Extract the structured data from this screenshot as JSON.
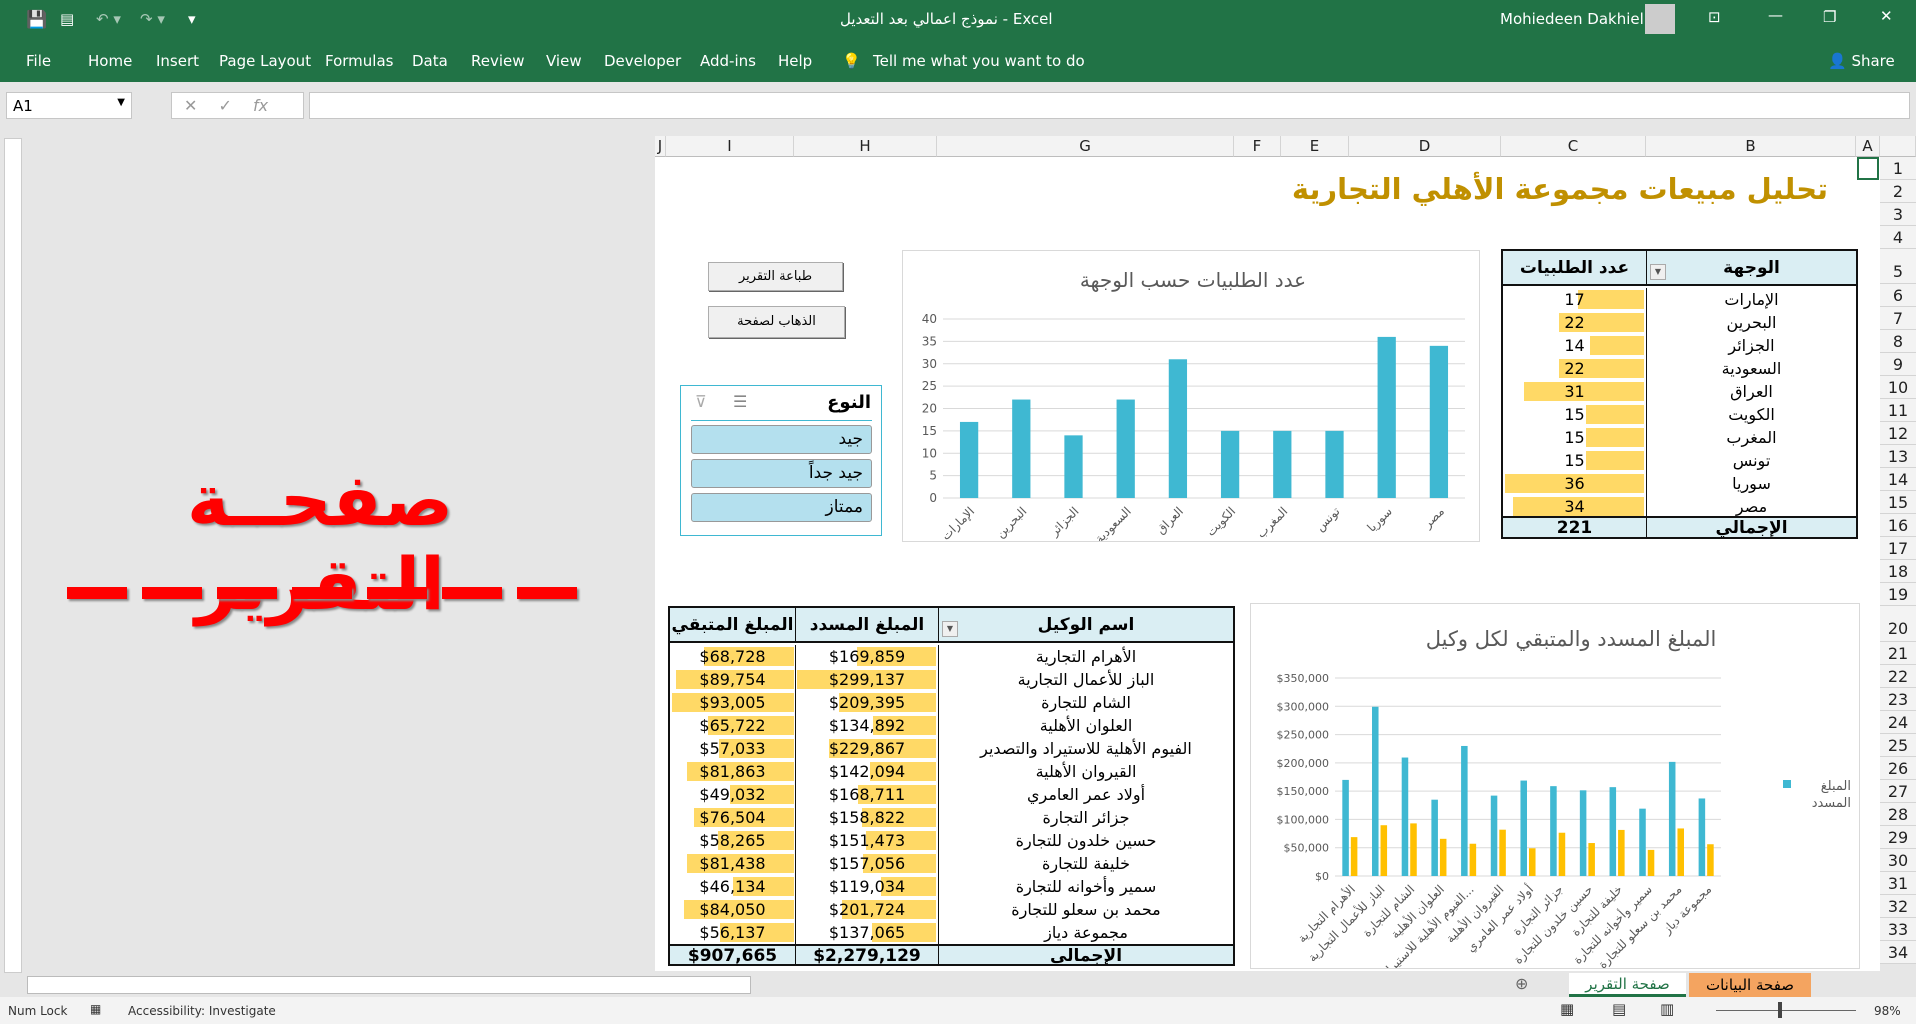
{
  "window": {
    "title": "نموذج اعمالي بعد التعديل  -  Excel",
    "user": "Mohiedeen Dakhiel"
  },
  "ribbon": {
    "tabs": [
      "File",
      "Home",
      "Insert",
      "Page Layout",
      "Formulas",
      "Data",
      "Review",
      "View",
      "Developer",
      "Add-ins",
      "Help"
    ],
    "tell_me": "Tell me what you want to do",
    "share": "Share"
  },
  "formula_bar": {
    "name_box": "A1",
    "formula": "",
    "cancel": "✕",
    "enter": "✓",
    "fx": "fx"
  },
  "columns": [
    "J",
    "I",
    "H",
    "G",
    "F",
    "E",
    "D",
    "C",
    "B",
    "A"
  ],
  "rows": [
    "1",
    "2",
    "3",
    "4",
    "5",
    "6",
    "7",
    "8",
    "9",
    "10",
    "11",
    "12",
    "13",
    "14",
    "15",
    "16",
    "17",
    "18",
    "19",
    "20",
    "21",
    "22",
    "23",
    "24",
    "25",
    "26",
    "27",
    "28",
    "29",
    "30",
    "31",
    "32",
    "33",
    "34"
  ],
  "report": {
    "title": "تحليل مبيعات مجموعة الأهلي التجارية",
    "big_label": "صفحــة التقرير",
    "title_color": "#c09000",
    "accent_red": "#ff0000"
  },
  "buttons": {
    "print": "طباعة التقرير",
    "goto": "الذهاب لصفحة"
  },
  "slicer": {
    "title": "النوع",
    "items": [
      "جيد",
      "جيد جداً",
      "ممتاز"
    ]
  },
  "dest_table": {
    "headers": [
      "الوجهة",
      "عدد الطلبيات"
    ],
    "rows": [
      [
        "الإمارات",
        17
      ],
      [
        "البحرين",
        22
      ],
      [
        "الجزائر",
        14
      ],
      [
        "السعودية",
        22
      ],
      [
        "العراق",
        31
      ],
      [
        "الكويت",
        15
      ],
      [
        "المغرب",
        15
      ],
      [
        "تونس",
        15
      ],
      [
        "سوريا",
        36
      ],
      [
        "مصر",
        34
      ]
    ],
    "total_label": "الإجمالي",
    "total": "221"
  },
  "agent_table": {
    "headers": [
      "اسم الوكيل",
      "المبلغ المسدد",
      "المبلغ المتبقي"
    ],
    "rows": [
      [
        "الأهرام التجارية",
        "$169,859",
        "$68,728"
      ],
      [
        "الباز للأعمال التجارية",
        "$299,137",
        "$89,754"
      ],
      [
        "الشام للتجارة",
        "$209,395",
        "$93,005"
      ],
      [
        "العلوان الأهلية",
        "$134,892",
        "$65,722"
      ],
      [
        "الفيوم الأهلية للاستيراد والتصدير",
        "$229,867",
        "$57,033"
      ],
      [
        "القيروان الأهلية",
        "$142,094",
        "$81,863"
      ],
      [
        "أولاد عمر العامري",
        "$168,711",
        "$49,032"
      ],
      [
        "جزائر التجارة",
        "$158,822",
        "$76,504"
      ],
      [
        "حسين خلدون للتجارة",
        "$151,473",
        "$58,265"
      ],
      [
        "خليفة للتجارة",
        "$157,056",
        "$81,438"
      ],
      [
        "سمير وأخوانه للتجارة",
        "$119,034",
        "$46,134"
      ],
      [
        "محمد بن سعلو للتجارة",
        "$201,724",
        "$84,050"
      ],
      [
        "مجموعة دياز",
        "$137,065",
        "$56,137"
      ]
    ],
    "total_label": "الإجمالي",
    "total_paid": "$2,279,129",
    "total_remaining": "$907,665"
  },
  "chart_data": [
    {
      "type": "bar",
      "title": "عدد الطلبيات حسب الوجهة",
      "categories": [
        "الإمارات",
        "البحرين",
        "الجزائر",
        "السعودية",
        "العراق",
        "الكويت",
        "المغرب",
        "تونس",
        "سوريا",
        "مصر"
      ],
      "values": [
        17,
        22,
        14,
        22,
        31,
        15,
        15,
        15,
        36,
        34
      ],
      "ylim": [
        0,
        40
      ],
      "yticks": [
        "0",
        "5",
        "10",
        "15",
        "20",
        "25",
        "30",
        "35",
        "40"
      ],
      "grid": true,
      "color": "#3fb8d2"
    },
    {
      "type": "bar",
      "title": "المبلغ المسدد والمتبقي لكل وكيل",
      "categories": [
        "الأهرام التجارية",
        "الباز للأعمال التجارية",
        "الشام للتجارة",
        "العلوان الأهلية",
        "الفيوم الأهلية للاستيراد...",
        "القيروان الأهلية",
        "أولاد عمر العامري",
        "جزائر التجارة",
        "حسين خلدون للتجارة",
        "خليفة للتجارة",
        "سمير وأخوانه للتجارة",
        "محمد بن سعلو للتجارة",
        "مجموعة دياز"
      ],
      "series": [
        {
          "name": "المبلغ المسدد",
          "values": [
            169859,
            299137,
            209395,
            134892,
            229867,
            142094,
            168711,
            158822,
            151473,
            157056,
            119034,
            201724,
            137065
          ],
          "color": "#3fb8d2"
        },
        {
          "values": [
            68728,
            89754,
            93005,
            65722,
            57033,
            81863,
            49032,
            76504,
            58265,
            81438,
            46134,
            84050,
            56137
          ],
          "color": "#ffc000"
        }
      ],
      "ylim": [
        0,
        350000
      ],
      "yticks": [
        "$0",
        "$50,000",
        "$100,000",
        "$150,000",
        "$200,000",
        "$250,000",
        "$300,000",
        "$350,000"
      ],
      "grid": true,
      "legend": "right"
    }
  ],
  "sheets": {
    "tabs": [
      "صفحة التقرير",
      "صفحة البيانات"
    ],
    "active": "صفحة التقرير",
    "data_tab_color": "#f4a460"
  },
  "status": {
    "num_lock": "Num Lock",
    "accessibility": "Accessibility: Investigate",
    "zoom": "98%"
  }
}
